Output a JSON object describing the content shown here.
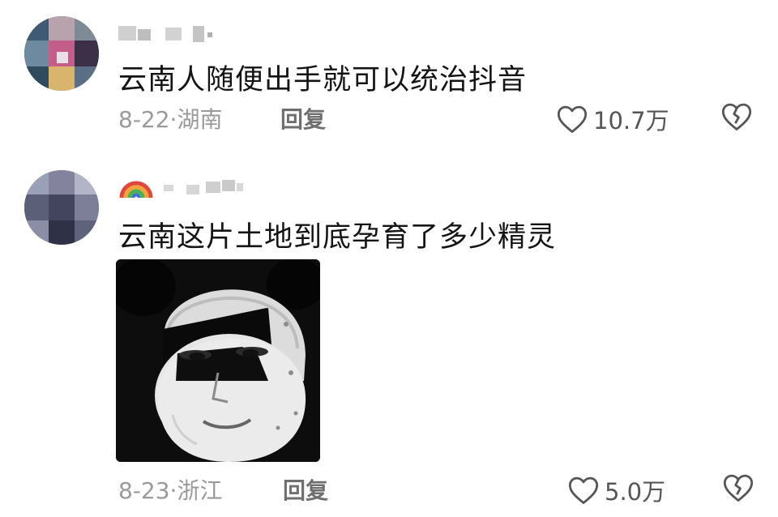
{
  "comments": [
    {
      "username": "",
      "text": "云南人随便出手就可以统治抖音",
      "date": "8-22",
      "separator": "·",
      "location": "湖南",
      "reply_label": "回复",
      "likes": "10.7万"
    },
    {
      "username": "",
      "text": "云南这片土地到底孕育了多少精灵",
      "date": "8-23",
      "separator": "·",
      "location": "浙江",
      "reply_label": "回复",
      "likes": "5.0万",
      "has_sticker": true
    }
  ],
  "icons": {
    "like": "heart-outline-icon",
    "dislike": "broken-heart-icon"
  },
  "colors": {
    "meta": "#9a9a9a",
    "text": "#141414"
  }
}
